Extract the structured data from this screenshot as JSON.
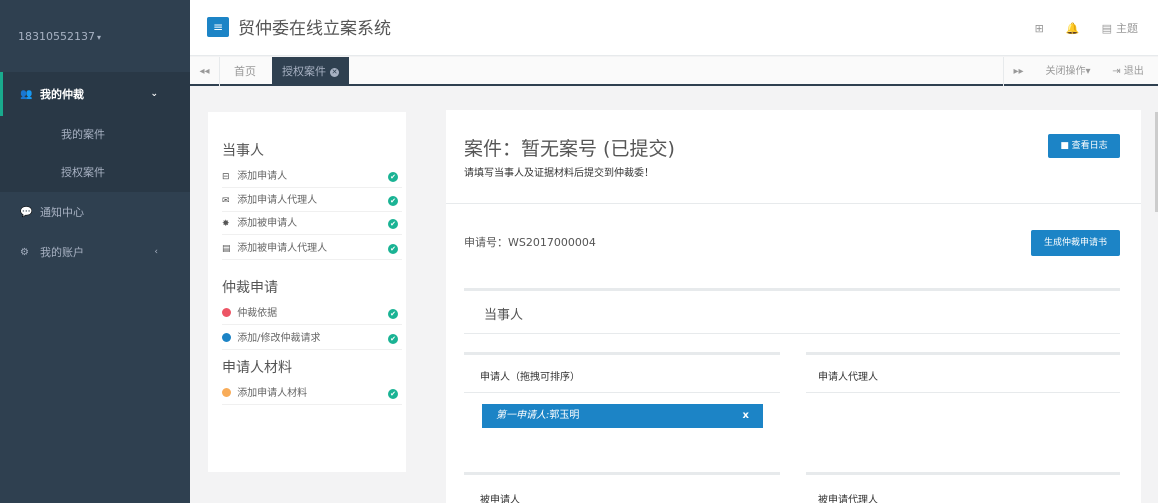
{
  "sidebar": {
    "user": "18310552137",
    "caret": "▾",
    "menu": {
      "my_arbitration": {
        "label": "我的仲裁",
        "arrow": "⌄"
      },
      "sub_items": [
        "我的案件",
        "授权案件"
      ],
      "notice": {
        "label": "通知中心"
      },
      "account": {
        "label": "我的账户",
        "arrow": "‹"
      }
    }
  },
  "topbar": {
    "menu_icon": "≡",
    "title": "贸仲委在线立案系统",
    "right": {
      "grid_icon": "⊞",
      "bell_icon": "🔔",
      "theme_label": "主题",
      "theme_icon": "▤"
    }
  },
  "tabs": {
    "prev": "◂◂",
    "home": "首页",
    "active": "授权案件",
    "next": "▸▸",
    "close_ops": "关闭操作▾",
    "logout": "⇥ 退出"
  },
  "left_nav": {
    "sections": [
      {
        "title": "当事人",
        "items": [
          {
            "icon": "⊟",
            "label": "添加申请人"
          },
          {
            "icon": "✉",
            "label": "添加申请人代理人"
          },
          {
            "icon": "✸",
            "label": "添加被申请人"
          },
          {
            "icon": "▤",
            "label": "添加被申请人代理人"
          }
        ]
      },
      {
        "title": "仲裁申请",
        "items": [
          {
            "color": "#ed5565",
            "label": "仲裁依据"
          },
          {
            "color": "#1c84c6",
            "label": "添加/修改仲裁请求"
          }
        ]
      },
      {
        "title": "申请人材料",
        "items": [
          {
            "color": "#f8ac59",
            "label": "添加申请人材料"
          }
        ]
      }
    ],
    "check": "✔"
  },
  "main": {
    "case_title": "案件：暂无案号 (已提交)",
    "hint": "请填写当事人及证据材料后提交到仲裁委！",
    "log_button": "■ 查看日志",
    "application_no": "申请号：WS2017000004",
    "generate_button": "生成仲裁申请书",
    "party_section": "当事人",
    "applicant_col": "申请人（拖拽可排序）",
    "applicant_agent_col": "申请人代理人",
    "respondent_col": "被申请人",
    "respondent_agent_col": "被申请代理人",
    "first_applicant_label": "第一申请人:",
    "first_applicant_name": "郭玉明",
    "chip_close": "x"
  }
}
